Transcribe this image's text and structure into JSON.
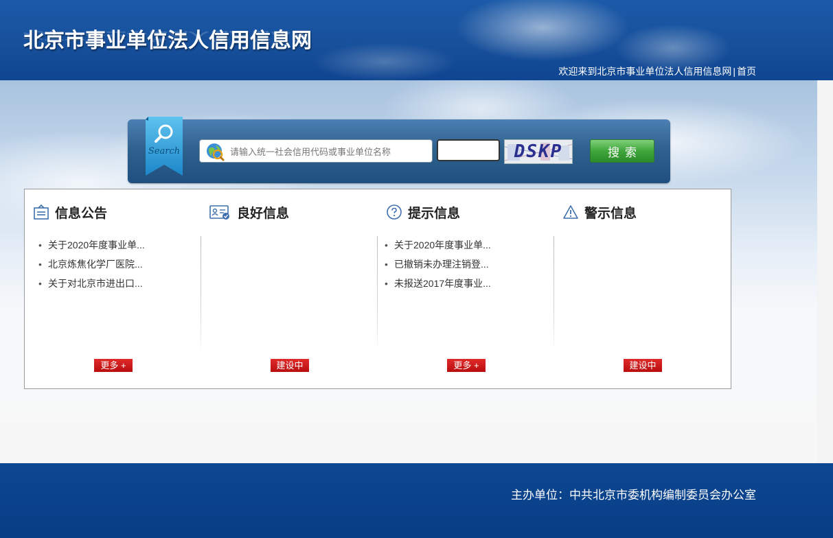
{
  "header": {
    "site_title": "北京市事业单位法人信用信息网",
    "welcome_text": "欢迎来到北京市事业单位法人信用信息网",
    "separator": "|",
    "home_link": "首页"
  },
  "search": {
    "ribbon_label": "Search",
    "placeholder": "请输入统一社会信用代码或事业单位名称",
    "query_value": "",
    "captcha_value": "",
    "captcha_text": "DSKP",
    "button_label": "搜索",
    "button_color": "#3fa63b"
  },
  "columns": [
    {
      "title": "信息公告",
      "icon": "notice-board-icon",
      "items": [
        "关于2020年度事业单...",
        "北京炼焦化学厂医院...",
        "关于对北京市进出口..."
      ],
      "button": "更多 +"
    },
    {
      "title": "良好信息",
      "icon": "id-card-check-icon",
      "items": [],
      "button": "建设中"
    },
    {
      "title": "提示信息",
      "icon": "question-circle-icon",
      "items": [
        "关于2020年度事业单...",
        "已撤销未办理注销登...",
        "未报送2017年度事业..."
      ],
      "button": "更多 +"
    },
    {
      "title": "警示信息",
      "icon": "warning-triangle-icon",
      "items": [],
      "button": "建设中"
    }
  ],
  "list_bullet": "•",
  "footer": {
    "host_text": "主办单位：中共北京市委机构编制委员会办公室"
  },
  "colors": {
    "header_blue": "#17509b",
    "footer_blue": "#083d85",
    "button_red": "#c81818",
    "icon_blue": "#3d6fae"
  }
}
